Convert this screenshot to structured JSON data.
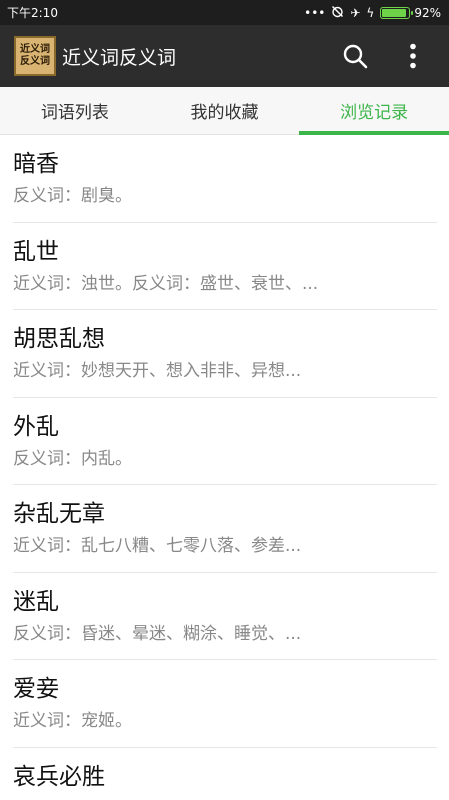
{
  "status_bar": {
    "time": "下午2:10",
    "icons": [
      "more-dots-icon",
      "alarm-off-icon",
      "airplane-icon",
      "charging-icon"
    ],
    "battery_percent_text": "92%",
    "battery_level": 0.92
  },
  "app_bar": {
    "logo_line1": "近义词",
    "logo_line2": "反义词",
    "title": "近义词反义词",
    "search_icon": "search-icon",
    "menu_icon": "more-vert-icon"
  },
  "tabs": [
    {
      "label": "词语列表",
      "active": false
    },
    {
      "label": "我的收藏",
      "active": false
    },
    {
      "label": "浏览记录",
      "active": true
    }
  ],
  "accent_color": "#3cb54a",
  "history": [
    {
      "word": "暗香",
      "detail": "反义词：剧臭。"
    },
    {
      "word": "乱世",
      "detail": "近义词：浊世。反义词：盛世、衰世、..."
    },
    {
      "word": "胡思乱想",
      "detail": "近义词：妙想天开、想入非非、异想..."
    },
    {
      "word": "外乱",
      "detail": "反义词：内乱。"
    },
    {
      "word": "杂乱无章",
      "detail": "近义词：乱七八糟、七零八落、参差..."
    },
    {
      "word": "迷乱",
      "detail": "反义词：昏迷、晕迷、糊涂、睡觉、..."
    },
    {
      "word": "爱妾",
      "detail": "近义词：宠姬。"
    },
    {
      "word": "哀兵必胜",
      "detail": ""
    }
  ]
}
